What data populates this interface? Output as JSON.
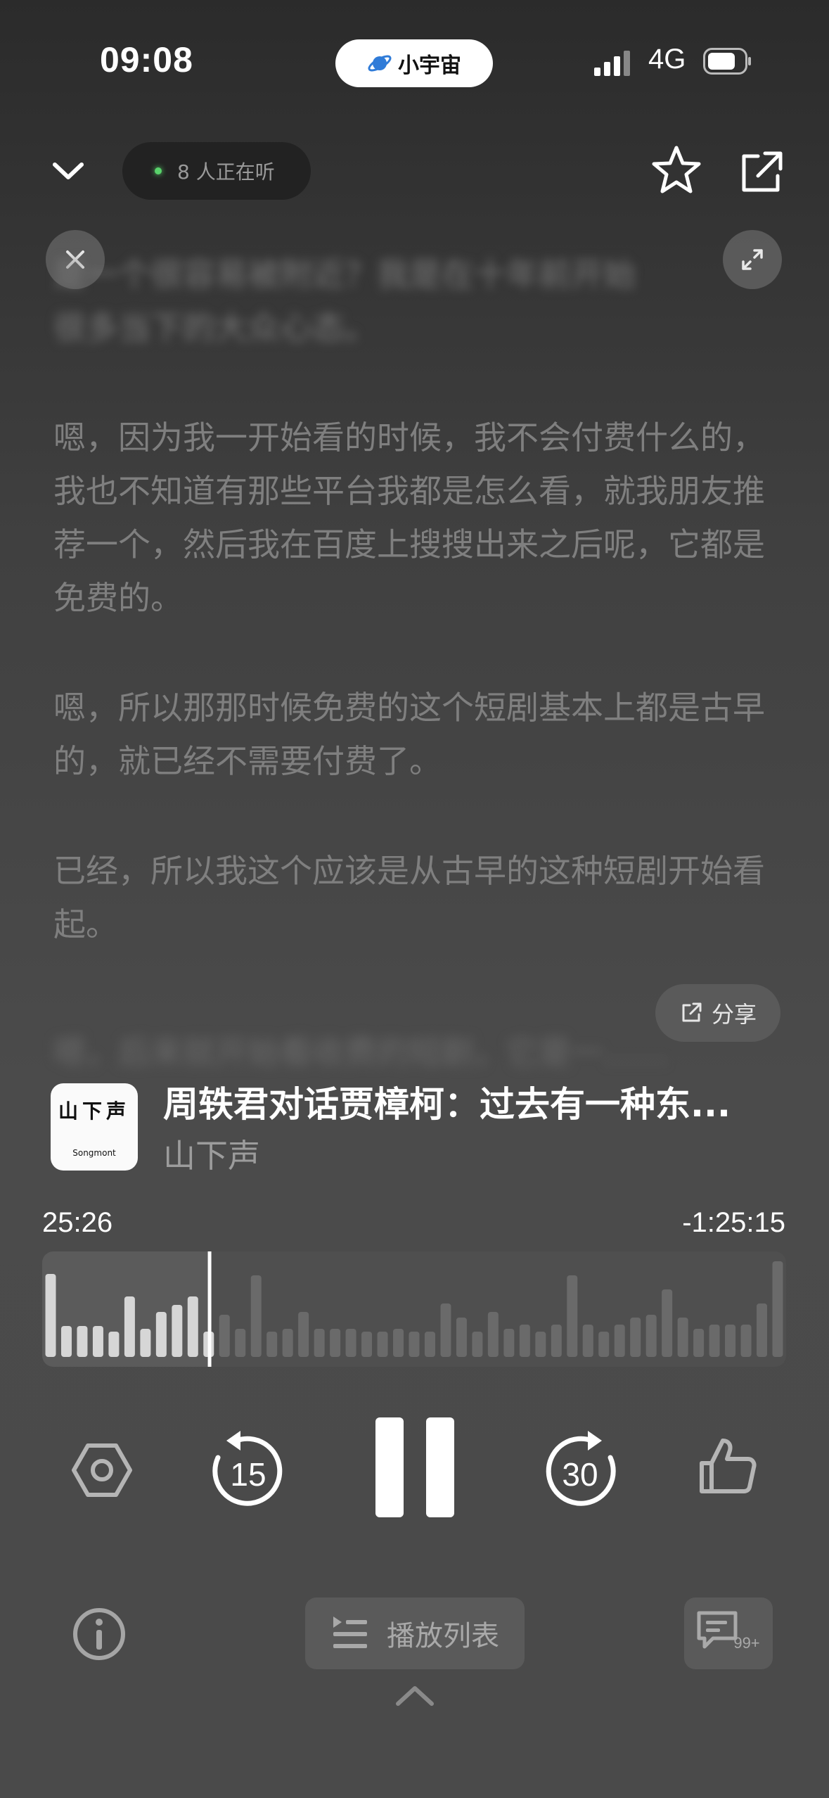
{
  "status_bar": {
    "time": "09:08",
    "app_pill": "小宇宙",
    "network": "4G",
    "battery_level": 0.7
  },
  "header": {
    "listeners": "8 人正在听"
  },
  "transcript": {
    "blurred_top_lines": [
      "是一个很容易被附近？我是在十年前开始",
      "很多当下的大众心态。"
    ],
    "paragraphs": [
      "嗯，因为我一开始看的时候，我不会付费什么的，我也不知道有那些平台我都是怎么看，就我朋友推荐一个，然后我在百度上搜搜出来之后呢，它都是免费的。",
      "嗯，所以那那时候免费的这个短剧基本上都是古早的，就已经不需要付费了。",
      "已经，所以我这个应该是从古早的这种短剧开始看起。"
    ],
    "blurred_bottom_line": "嗯，后来就开始看收费的短剧，它是一……"
  },
  "share_label": "分享",
  "episode": {
    "cover_title": "山下声",
    "cover_subtitle": "Songmont",
    "title": "周轶君对话贾樟柯：过去有一种东...",
    "show": "山下声"
  },
  "playback": {
    "elapsed": "25:26",
    "remaining": "-1:25:15",
    "progress": 0.225,
    "rewind_seconds": "15",
    "forward_seconds": "30"
  },
  "bottom_bar": {
    "playlist_label": "播放列表",
    "comment_count": "99+"
  }
}
